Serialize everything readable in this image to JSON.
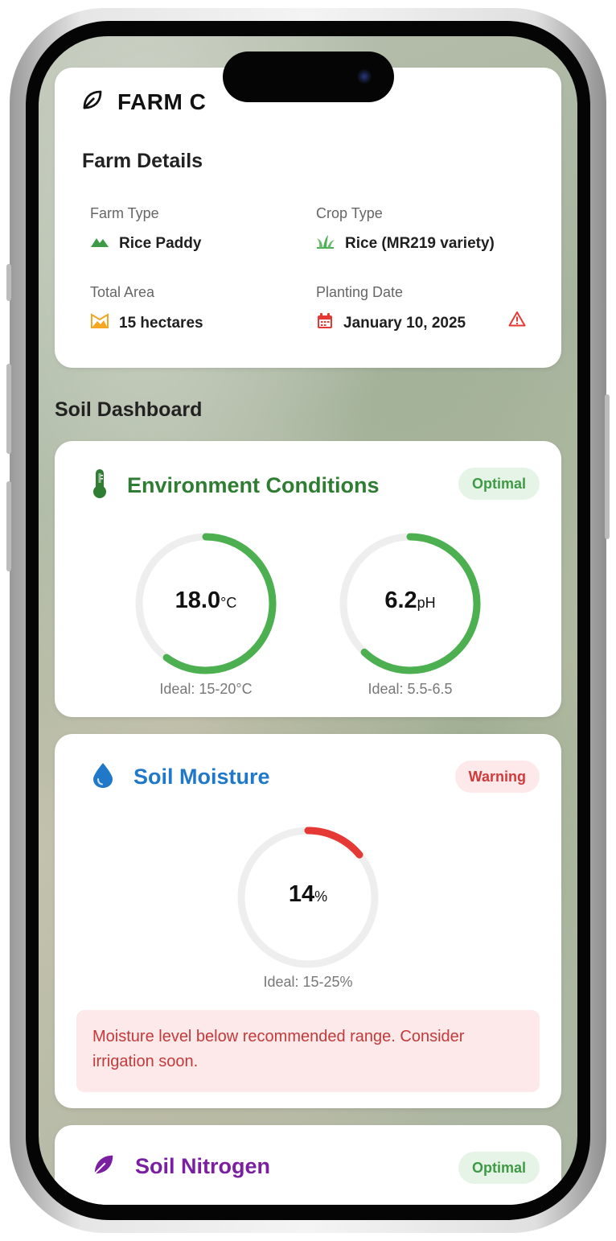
{
  "farm": {
    "name": "FARM C",
    "section_title": "Farm Details",
    "details": {
      "farm_type": {
        "label": "Farm Type",
        "value": "Rice Paddy"
      },
      "crop_type": {
        "label": "Crop Type",
        "value": "Rice (MR219 variety)"
      },
      "total_area": {
        "label": "Total Area",
        "value": "15 hectares"
      },
      "planting_date": {
        "label": "Planting Date",
        "value": "January 10, 2025"
      }
    }
  },
  "dashboard": {
    "title": "Soil Dashboard",
    "environment": {
      "title": "Environment Conditions",
      "status": "Optimal",
      "temperature": {
        "value": "18.0",
        "unit": "°C",
        "ideal": "Ideal: 15-20°C",
        "fill_fraction": 0.6
      },
      "ph": {
        "value": "6.2",
        "unit": "pH",
        "ideal": "Ideal: 5.5-6.5",
        "fill_fraction": 0.62
      }
    },
    "moisture": {
      "title": "Soil Moisture",
      "status": "Warning",
      "value": "14",
      "unit": "%",
      "ideal": "Ideal: 15-25%",
      "fill_fraction": 0.14,
      "alert": "Moisture level below recommended range. Consider irrigation soon."
    },
    "nitrogen": {
      "title": "Soil Nitrogen",
      "status": "Optimal"
    }
  },
  "colors": {
    "green_accent": "#2e7d32",
    "gauge_green": "#4caf50",
    "gauge_red": "#e53935",
    "blue_accent": "#1f78c8",
    "purple_accent": "#7b1fa2"
  }
}
